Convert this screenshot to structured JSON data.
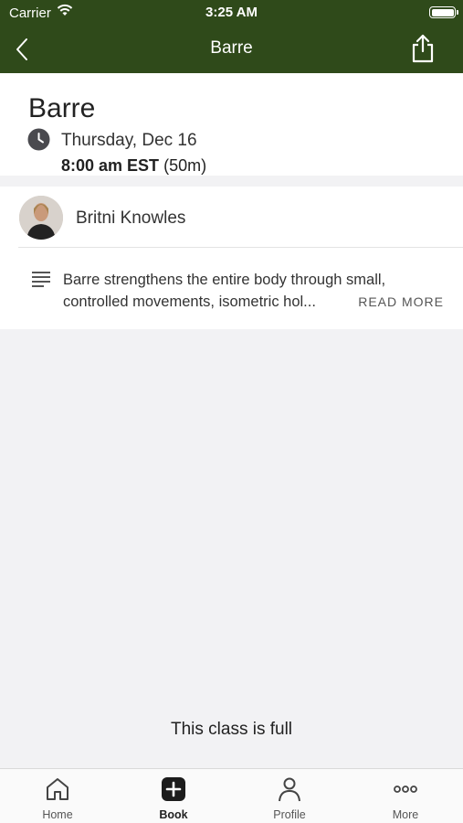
{
  "status_bar": {
    "carrier": "Carrier",
    "time": "3:25 AM"
  },
  "nav": {
    "title": "Barre",
    "back_icon": "chevron-left-icon",
    "share_icon": "share-icon"
  },
  "class": {
    "name": "Barre",
    "date": "Thursday, Dec 16",
    "time": "8:00 am EST",
    "duration": "(50m)"
  },
  "instructor": {
    "name": "Britni Knowles"
  },
  "description": {
    "text": "Barre strengthens the entire body through small, controlled movements, isometric hol...",
    "read_more": "READ MORE"
  },
  "footer": {
    "status": "This class is full"
  },
  "tabs": [
    {
      "label": "Home",
      "icon": "home-icon",
      "active": false
    },
    {
      "label": "Book",
      "icon": "plus-square-icon",
      "active": true
    },
    {
      "label": "Profile",
      "icon": "person-icon",
      "active": false
    },
    {
      "label": "More",
      "icon": "more-dots-icon",
      "active": false
    }
  ],
  "colors": {
    "header_bg": "#2f4a1a",
    "accent": "#222222"
  }
}
